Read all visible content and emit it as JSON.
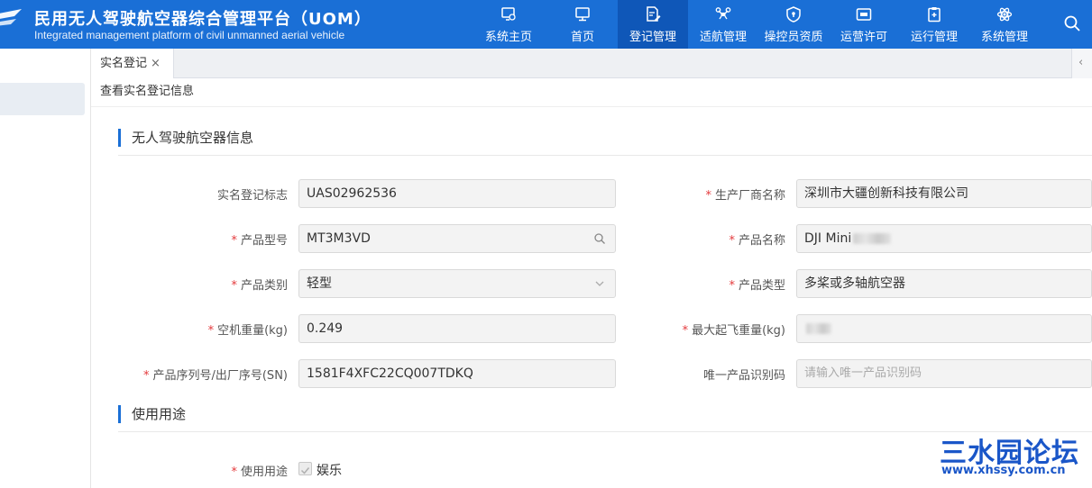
{
  "header": {
    "title": "民用无人驾驶航空器综合管理平台（UOM）",
    "subtitle": "Integrated management platform of civil unmanned aerial vehicle",
    "bg_color": "#1a6fd6",
    "active_color": "#0f57b8",
    "nav": [
      {
        "label": "系统主页",
        "icon": "monitor-gear-icon"
      },
      {
        "label": "首页",
        "icon": "desktop-icon"
      },
      {
        "label": "登记管理",
        "icon": "document-edit-icon",
        "active": true
      },
      {
        "label": "适航管理",
        "icon": "drone-icon"
      },
      {
        "label": "操控员资质",
        "icon": "shield-icon"
      },
      {
        "label": "运营许可",
        "icon": "id-card-icon"
      },
      {
        "label": "运行管理",
        "icon": "clipboard-icon"
      },
      {
        "label": "系统管理",
        "icon": "atom-icon"
      }
    ],
    "search_icon": "search-icon"
  },
  "tabs": [
    {
      "label": "实名登记",
      "close": "×"
    }
  ],
  "tab_scroll_glyph": "‹",
  "breadcrumb": "查看实名登记信息",
  "sections": {
    "uav_info": "无人驾驶航空器信息",
    "usage": "使用用途"
  },
  "form": {
    "reg_id": {
      "label": "实名登记标志",
      "value": "UAS02962536",
      "required": false
    },
    "manufacturer": {
      "label": "生产厂商名称",
      "value": "深圳市大疆创新科技有限公司",
      "required": true
    },
    "model": {
      "label": "产品型号",
      "value": "MT3M3VD",
      "required": true
    },
    "product_name": {
      "label": "产品名称",
      "value": "DJI Mini",
      "required": true
    },
    "category": {
      "label": "产品类别",
      "value": "轻型",
      "required": true
    },
    "product_type": {
      "label": "产品类型",
      "value": "多桨或多轴航空器",
      "required": true
    },
    "empty_weight": {
      "label": "空机重量(kg)",
      "value": "0.249",
      "required": true
    },
    "max_takeoff_weight": {
      "label": "最大起飞重量(kg)",
      "value": "",
      "required": true
    },
    "serial": {
      "label": "产品序列号/出厂序号(SN)",
      "value": "1581F4XFC22CQ007TDKQ",
      "required": true
    },
    "unique_id": {
      "label": "唯一产品识别码",
      "placeholder": "请输入唯一产品识别码",
      "required": false
    },
    "usage": {
      "label": "使用用途",
      "option": "娱乐",
      "checked": true,
      "required": true
    }
  },
  "required_mark": "*",
  "watermark": {
    "big": "三水园论坛",
    "small": "www.xhssy.com.cn",
    "color": "#1a56c8"
  }
}
